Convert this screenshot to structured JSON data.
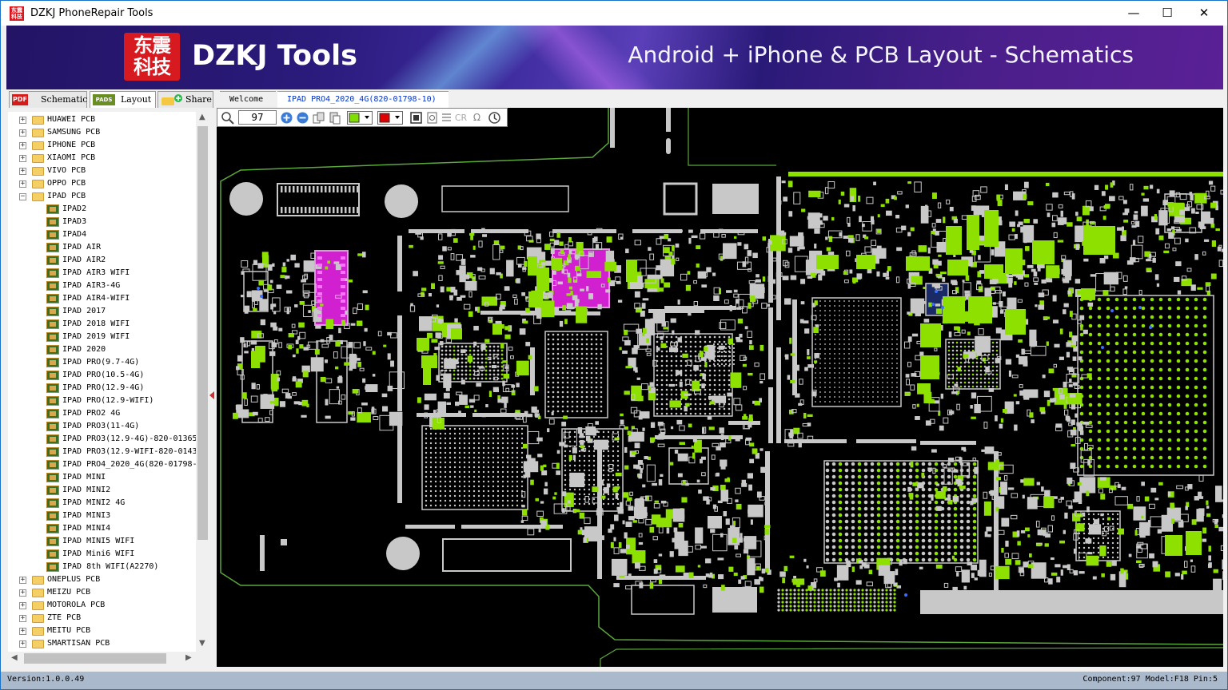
{
  "window": {
    "title": "DZKJ PhoneRepair Tools",
    "minimize": "—",
    "maximize": "☐",
    "close": "✕"
  },
  "banner": {
    "logo_text": "东震\n科技",
    "brand": "DZKJ Tools",
    "tagline": "Android + iPhone & PCB Layout - Schematics"
  },
  "left_tabs": [
    {
      "icon": "PDF",
      "label": "Schematic",
      "icon_color": "#d41c1c"
    },
    {
      "icon": "PADS",
      "label": "Layout",
      "icon_color": "#6b8e23"
    },
    {
      "icon": "share-icon",
      "label": "Share",
      "icon_color": "#1aa0e0"
    }
  ],
  "doc_tabs": [
    {
      "label": "Welcome"
    },
    {
      "label": "IPAD PRO4_2020_4G(820-01798-10)",
      "close": "☒"
    }
  ],
  "tree": {
    "top_folders_before": [
      "HUAWEI PCB",
      "SAMSUNG PCB",
      "IPHONE PCB",
      "XIAOMI PCB",
      "VIVO PCB",
      "OPPO PCB"
    ],
    "expanded_folder": "IPAD PCB",
    "ipad_items": [
      "IPAD2",
      "IPAD3",
      "IPAD4",
      "IPAD AIR",
      "IPAD AIR2",
      "IPAD AIR3 WIFI",
      "IPAD AIR3-4G",
      "IPAD AIR4-WIFI",
      "IPAD 2017",
      "IPAD 2018 WIFI",
      "IPAD 2019 WIFI",
      "IPAD 2020",
      "IPAD PRO(9.7-4G)",
      "IPAD PRO(10.5-4G)",
      "IPAD PRO(12.9-4G)",
      "IPAD PRO(12.9-WIFI)",
      "IPAD PRO2 4G",
      "IPAD PRO3(11-4G)",
      "IPAD PRO3(12.9-4G)-820-01365",
      "IPAD PRO3(12.9-WIFI-820-0143",
      "IPAD PRO4_2020_4G(820-01798-",
      "IPAD MINI",
      "IPAD MINI2",
      "IPAD MINI2 4G",
      "IPAD MINI3",
      "IPAD MINI4",
      "IPAD MINI5 WIFI",
      "IPAD Mini6 WIFI",
      "IPAD 8th WIFI(A2270)"
    ],
    "top_folders_after": [
      "ONEPLUS PCB",
      "MEIZU PCB",
      "MOTOROLA PCB",
      "ZTE PCB",
      "MEITU PCB",
      "SMARTISAN PCB"
    ]
  },
  "toolbar": {
    "zoom_value": "97",
    "icons": [
      "magnifier-icon",
      "zoom-in-icon",
      "zoom-out-icon",
      "copy-icon",
      "paste-icon",
      "color-green-select",
      "color-red-select",
      "layers-icon",
      "note-icon",
      "list-icon",
      "cr-icon",
      "omega-icon",
      "rotate-icon"
    ],
    "cr_label": "CR",
    "omega_label": "Ω",
    "green": "#7fe000",
    "red": "#e00000"
  },
  "status": {
    "version": "Version:1.0.0.49",
    "info": "Component:97 Model:F18 Pin:5"
  },
  "colors": {
    "board_bg": "#000000",
    "pad_green": "#8ee000",
    "pad_grey": "#c8c8c8",
    "highlight_magenta": "#d020d0",
    "outline_green": "#5aa83a"
  }
}
